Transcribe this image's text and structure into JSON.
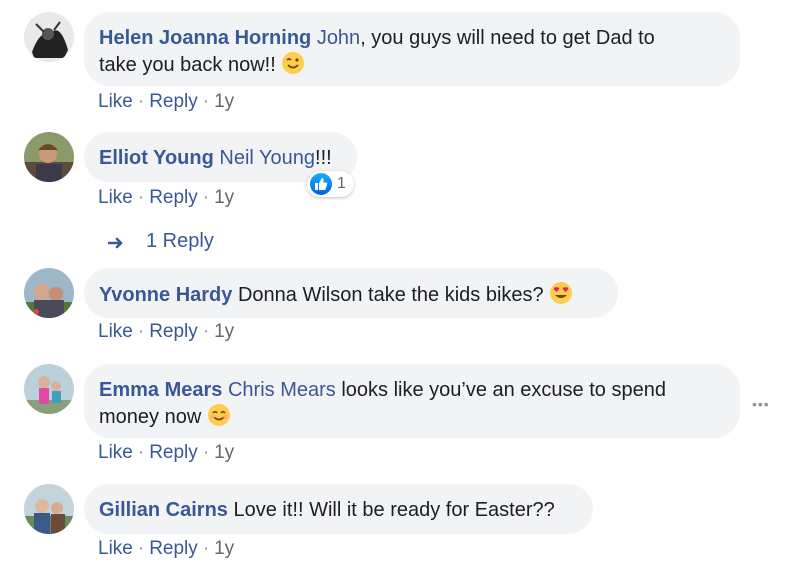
{
  "comments": [
    {
      "author": "Helen Joanna Horning",
      "mention": "John",
      "text_line1": ", you guys will need to get Dad to",
      "text_line2": "take you back now!!",
      "emoji": "wink-emoji",
      "actions": {
        "like": "Like",
        "reply": "Reply",
        "time": "1y"
      }
    },
    {
      "author": "Elliot Young",
      "mention": "Neil Young",
      "text": "!!!",
      "reaction_count": "1",
      "reaction_icon": "thumbs-up-icon",
      "actions": {
        "like": "Like",
        "reply": "Reply",
        "time": "1y"
      },
      "replies_link": "1 Reply"
    },
    {
      "author": "Yvonne Hardy",
      "text": "Donna Wilson take the kids bikes?",
      "emoji": "heart-eyes-emoji",
      "actions": {
        "like": "Like",
        "reply": "Reply",
        "time": "1y"
      }
    },
    {
      "author": "Emma Mears",
      "mention": "Chris Mears",
      "text_line1": " looks like you’ve an excuse to spend",
      "text_line2": "money now",
      "emoji": "smiling-emoji",
      "actions": {
        "like": "Like",
        "reply": "Reply",
        "time": "1y"
      },
      "more_icon": "more-options-icon"
    },
    {
      "author": "Gillian Cairns",
      "text": "Love it!! Will it be ready for Easter??",
      "actions": {
        "like": "Like",
        "reply": "Reply",
        "time": "1y"
      }
    }
  ],
  "separator": "·",
  "colors": {
    "link": "#385898",
    "bubble": "#f2f3f5",
    "time": "#606770"
  }
}
